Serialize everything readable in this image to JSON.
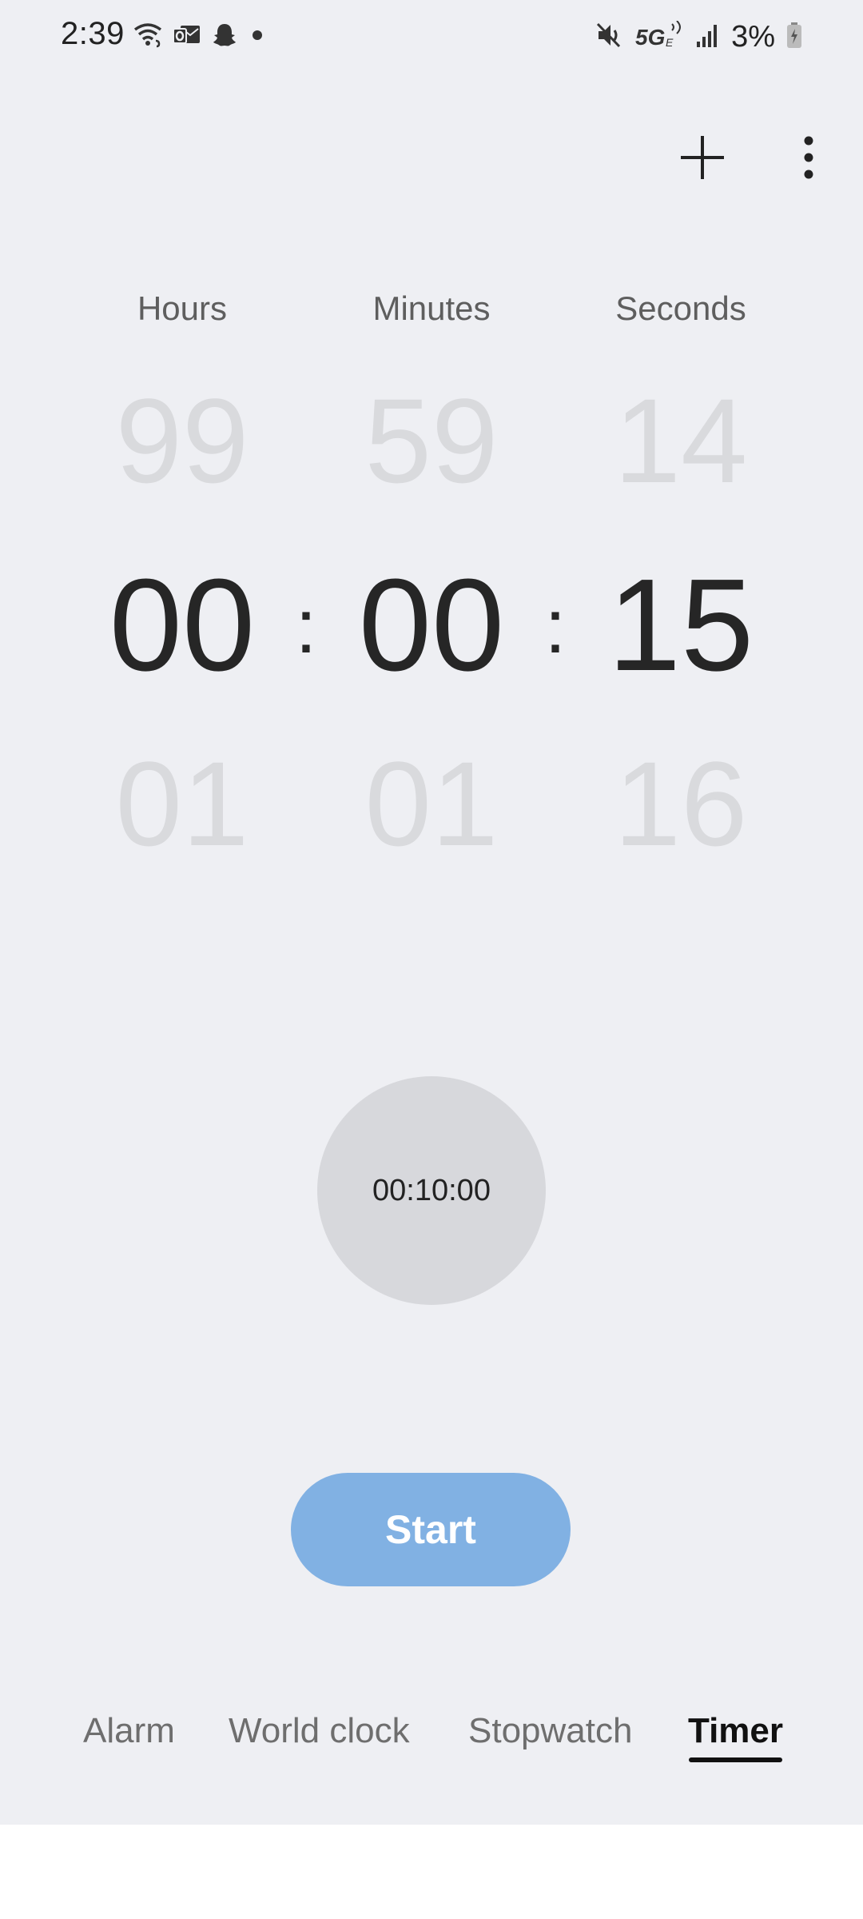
{
  "status_bar": {
    "time": "2:39",
    "battery_text": "3%",
    "network": "5G",
    "left_icons": [
      "wifi-calling-icon",
      "outlook-icon",
      "snapchat-icon",
      "dot-icon"
    ],
    "right_icons": [
      "mute-icon",
      "5g-icon",
      "signal-icon",
      "battery-charging-icon"
    ]
  },
  "toolbar": {
    "add_icon": "plus-icon",
    "more_icon": "more-vert-icon"
  },
  "picker": {
    "labels": {
      "hours": "Hours",
      "minutes": "Minutes",
      "seconds": "Seconds"
    },
    "previous": {
      "hours": "99",
      "minutes": "59",
      "seconds": "14"
    },
    "current": {
      "hours": "00",
      "minutes": "00",
      "seconds": "15"
    },
    "next": {
      "hours": "01",
      "minutes": "01",
      "seconds": "16"
    },
    "separator": ":"
  },
  "preset": {
    "label": "00:10:00"
  },
  "start_button": {
    "label": "Start"
  },
  "tabs": [
    {
      "label": "Alarm",
      "selected": false
    },
    {
      "label": "World clock",
      "selected": false
    },
    {
      "label": "Stopwatch",
      "selected": false
    },
    {
      "label": "Timer",
      "selected": true
    }
  ],
  "colors": {
    "background": "#eeeff3",
    "accent": "#81b1e3",
    "preset_circle": "#d7d8dc",
    "dim_number": "#d9dadd"
  }
}
